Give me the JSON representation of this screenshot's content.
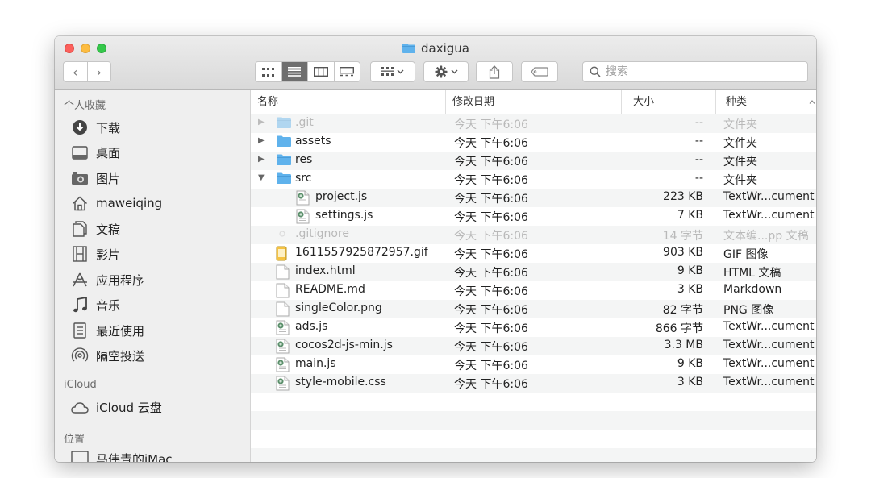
{
  "window": {
    "title": "daxigua"
  },
  "toolbar": {
    "back": "‹",
    "forward": "›",
    "search_placeholder": "搜索"
  },
  "sidebar": {
    "favorites_title": "个人收藏",
    "favorites": [
      {
        "label": "下载",
        "icon": "download-icon"
      },
      {
        "label": "桌面",
        "icon": "desktop-icon"
      },
      {
        "label": "图片",
        "icon": "camera-icon"
      },
      {
        "label": "maweiqing",
        "icon": "home-icon"
      },
      {
        "label": "文稿",
        "icon": "documents-icon"
      },
      {
        "label": "影片",
        "icon": "film-icon"
      },
      {
        "label": "应用程序",
        "icon": "applications-icon"
      },
      {
        "label": "音乐",
        "icon": "music-icon"
      },
      {
        "label": "最近使用",
        "icon": "recents-icon"
      },
      {
        "label": "隔空投送",
        "icon": "airdrop-icon"
      }
    ],
    "icloud_title": "iCloud",
    "icloud": [
      {
        "label": "iCloud 云盘",
        "icon": "cloud-icon"
      }
    ],
    "locations_title": "位置",
    "locations": [
      {
        "label": "马伟青的iMac",
        "icon": "imac-icon"
      }
    ]
  },
  "columns": {
    "name": "名称",
    "date": "修改日期",
    "size": "大小",
    "kind": "种类"
  },
  "files": [
    {
      "name": ".git",
      "date": "今天 下午6:06",
      "size": "--",
      "kind": "文件夹",
      "icon": "folder",
      "depth": 0,
      "disclosure": "collapsed",
      "dim": true
    },
    {
      "name": "assets",
      "date": "今天 下午6:06",
      "size": "--",
      "kind": "文件夹",
      "icon": "folder",
      "depth": 0,
      "disclosure": "collapsed",
      "dim": false
    },
    {
      "name": "res",
      "date": "今天 下午6:06",
      "size": "--",
      "kind": "文件夹",
      "icon": "folder",
      "depth": 0,
      "disclosure": "collapsed",
      "dim": false
    },
    {
      "name": "src",
      "date": "今天 下午6:06",
      "size": "--",
      "kind": "文件夹",
      "icon": "folder",
      "depth": 0,
      "disclosure": "expanded",
      "dim": false
    },
    {
      "name": "project.js",
      "date": "今天 下午6:06",
      "size": "223 KB",
      "kind": "TextWr...cument",
      "icon": "script",
      "depth": 1,
      "disclosure": "none",
      "dim": false
    },
    {
      "name": "settings.js",
      "date": "今天 下午6:06",
      "size": "7 KB",
      "kind": "TextWr...cument",
      "icon": "script",
      "depth": 1,
      "disclosure": "none",
      "dim": false
    },
    {
      "name": ".gitignore",
      "date": "今天 下午6:06",
      "size": "14 字节",
      "kind": "文本编...pp 文稿",
      "icon": "hidden",
      "depth": 0,
      "disclosure": "none",
      "dim": true
    },
    {
      "name": "1611557925872957.gif",
      "date": "今天 下午6:06",
      "size": "903 KB",
      "kind": "GIF 图像",
      "icon": "gif",
      "depth": 0,
      "disclosure": "none",
      "dim": false
    },
    {
      "name": "index.html",
      "date": "今天 下午6:06",
      "size": "9 KB",
      "kind": "HTML 文稿",
      "icon": "doc",
      "depth": 0,
      "disclosure": "none",
      "dim": false
    },
    {
      "name": "README.md",
      "date": "今天 下午6:06",
      "size": "3 KB",
      "kind": "Markdown",
      "icon": "doc",
      "depth": 0,
      "disclosure": "none",
      "dim": false
    },
    {
      "name": "singleColor.png",
      "date": "今天 下午6:06",
      "size": "82 字节",
      "kind": "PNG 图像",
      "icon": "image",
      "depth": 0,
      "disclosure": "none",
      "dim": false
    },
    {
      "name": "ads.js",
      "date": "今天 下午6:06",
      "size": "866 字节",
      "kind": "TextWr...cument",
      "icon": "script",
      "depth": 0,
      "disclosure": "none",
      "dim": false
    },
    {
      "name": "cocos2d-js-min.js",
      "date": "今天 下午6:06",
      "size": "3.3 MB",
      "kind": "TextWr...cument",
      "icon": "script",
      "depth": 0,
      "disclosure": "none",
      "dim": false
    },
    {
      "name": "main.js",
      "date": "今天 下午6:06",
      "size": "9 KB",
      "kind": "TextWr...cument",
      "icon": "script",
      "depth": 0,
      "disclosure": "none",
      "dim": false
    },
    {
      "name": "style-mobile.css",
      "date": "今天 下午6:06",
      "size": "3 KB",
      "kind": "TextWr...cument",
      "icon": "script",
      "depth": 0,
      "disclosure": "none",
      "dim": false
    }
  ],
  "colors": {
    "folder": "#5fb2ec",
    "accent": "#6e6e6e"
  }
}
